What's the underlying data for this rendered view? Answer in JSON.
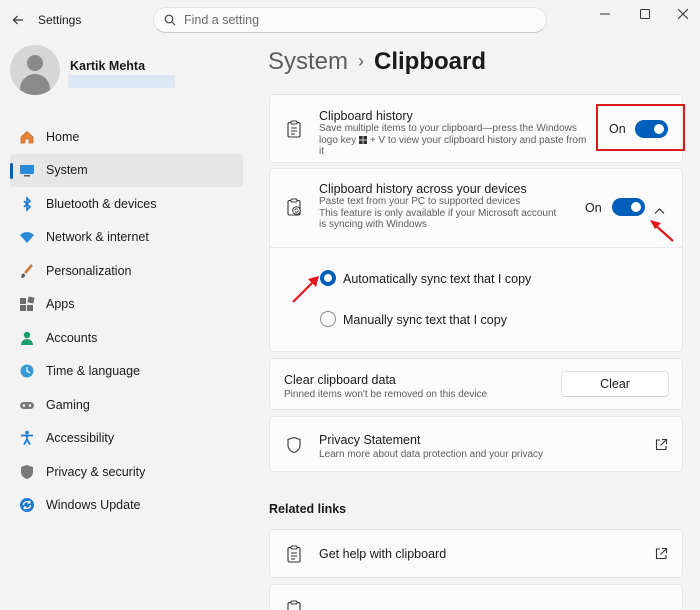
{
  "window": {
    "title": "Settings"
  },
  "search": {
    "placeholder": "Find a setting"
  },
  "profile": {
    "name": "Kartik Mehta"
  },
  "nav": [
    {
      "label": "Home",
      "icon": "home-icon"
    },
    {
      "label": "System",
      "icon": "system-icon",
      "active": true
    },
    {
      "label": "Bluetooth & devices",
      "icon": "bluetooth-icon"
    },
    {
      "label": "Network & internet",
      "icon": "wifi-icon"
    },
    {
      "label": "Personalization",
      "icon": "brush-icon"
    },
    {
      "label": "Apps",
      "icon": "apps-icon"
    },
    {
      "label": "Accounts",
      "icon": "accounts-icon"
    },
    {
      "label": "Time & language",
      "icon": "globe-icon"
    },
    {
      "label": "Gaming",
      "icon": "gamepad-icon"
    },
    {
      "label": "Accessibility",
      "icon": "accessibility-icon"
    },
    {
      "label": "Privacy & security",
      "icon": "shield-icon"
    },
    {
      "label": "Windows Update",
      "icon": "update-icon"
    }
  ],
  "breadcrumb": {
    "parent": "System",
    "separator": "›",
    "current": "Clipboard"
  },
  "clipboard_history": {
    "title": "Clipboard history",
    "desc_1": "Save multiple items to your clipboard—press the Windows",
    "desc_2_pre": "logo key",
    "desc_2_post": "+ V to view your clipboard history and paste from",
    "desc_3": "it",
    "state": "On"
  },
  "sync": {
    "title": "Clipboard history across your devices",
    "desc_1": "Paste text from your PC to supported devices",
    "desc_2": "This feature is only available if your Microsoft account",
    "desc_3": "is syncing with Windows",
    "state": "On",
    "option_auto": "Automatically sync text that I copy",
    "option_manual": "Manually sync text that I copy"
  },
  "clear": {
    "title": "Clear clipboard data",
    "desc": "Pinned items won't be removed on this device",
    "button": "Clear"
  },
  "privacy": {
    "title": "Privacy Statement",
    "desc": "Learn more about data protection and your privacy"
  },
  "related": {
    "heading": "Related links",
    "help": "Get help with clipboard"
  },
  "colors": {
    "accent": "#005fb8",
    "annotation": "#e0161b"
  }
}
